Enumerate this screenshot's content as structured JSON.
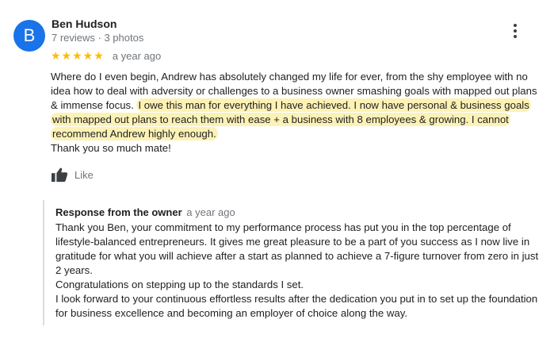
{
  "reviewer": {
    "initial": "B",
    "name": "Ben Hudson",
    "meta": "7 reviews · 3 photos",
    "avatar_color": "#1a73e8"
  },
  "rating": {
    "stars_text": "★★★★★",
    "value": 5,
    "max": 5,
    "time_ago": "a year ago",
    "star_color": "#fbbc04"
  },
  "review": {
    "text_plain": "Where do I even begin, Andrew has absolutely changed my life for ever, from the shy employee with no idea how to deal with adversity or challenges to a business owner smashing goals with mapped out plans & immense focus. ",
    "text_highlighted": "I owe this man for everything I have achieved. I now have personal & business goals with mapped out plans to reach them with ease + a business with 8 employees & growing. I cannot recommend Andrew highly enough.",
    "closing": "Thank you so much mate!",
    "highlight_color": "#fdf2b5"
  },
  "actions": {
    "like_label": "Like",
    "more_icon": "more-vertical-icon"
  },
  "owner_response": {
    "title": "Response from the owner",
    "time_ago": "a year ago",
    "paragraph_1": "Thank you Ben, your commitment to my performance process has put you in the top percentage of lifestyle-balanced entrepreneurs. It gives me great pleasure to be a part of you success as I now live in gratitude for what you will achieve after a start as planned to achieve a 7-figure turnover from zero in just 2 years.",
    "paragraph_2": "Congratulations on stepping up to the standards I set.",
    "paragraph_3": "I look forward to your continuous effortless results after the dedication you put in to set up the foundation for business excellence and becoming an employer of choice along the way."
  }
}
